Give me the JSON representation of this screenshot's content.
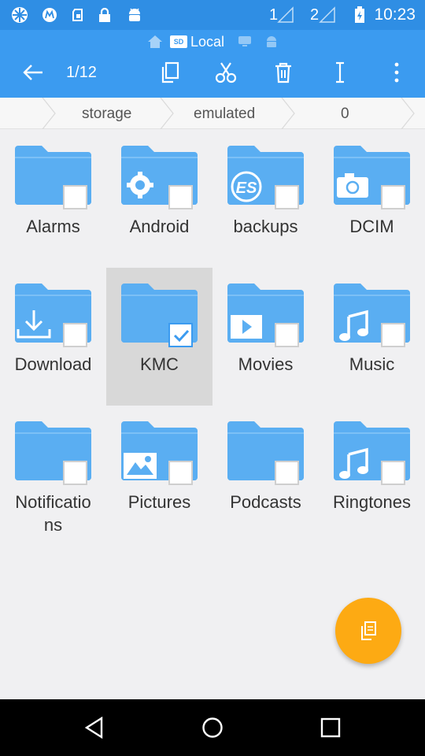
{
  "status_bar": {
    "time": "10:23",
    "sim1_label": "1",
    "sim2_label": "2",
    "icons": [
      "app-icon",
      "motorola-icon",
      "sim-icon",
      "lock-icon",
      "android-icon",
      "signal-icon",
      "battery-icon"
    ]
  },
  "location": {
    "label": "Local",
    "sd_badge": "SD"
  },
  "toolbar": {
    "selection_count": "1/12",
    "actions": [
      "back",
      "copy",
      "cut",
      "delete",
      "rename",
      "more"
    ]
  },
  "breadcrumb": [
    "storage",
    "emulated",
    "0"
  ],
  "folders": [
    {
      "name": "Alarms",
      "badge": "none",
      "checked": false
    },
    {
      "name": "Android",
      "badge": "gear",
      "checked": false
    },
    {
      "name": "backups",
      "badge": "es",
      "checked": false
    },
    {
      "name": "DCIM",
      "badge": "camera",
      "checked": false
    },
    {
      "name": "Download",
      "badge": "download",
      "checked": false
    },
    {
      "name": "KMC",
      "badge": "none",
      "checked": true
    },
    {
      "name": "Movies",
      "badge": "play",
      "checked": false
    },
    {
      "name": "Music",
      "badge": "music",
      "checked": false
    },
    {
      "name": "Notifications",
      "label_line1": "Notificatio",
      "label_line2": "ns",
      "badge": "none",
      "checked": false
    },
    {
      "name": "Pictures",
      "badge": "image",
      "checked": false
    },
    {
      "name": "Podcasts",
      "badge": "none",
      "checked": false
    },
    {
      "name": "Ringtones",
      "badge": "music",
      "checked": false
    }
  ],
  "colors": {
    "header": "#3b9bf0",
    "status_bar": "#2f8ee4",
    "folder": "#5aaef2",
    "fab": "#fdaa13"
  }
}
